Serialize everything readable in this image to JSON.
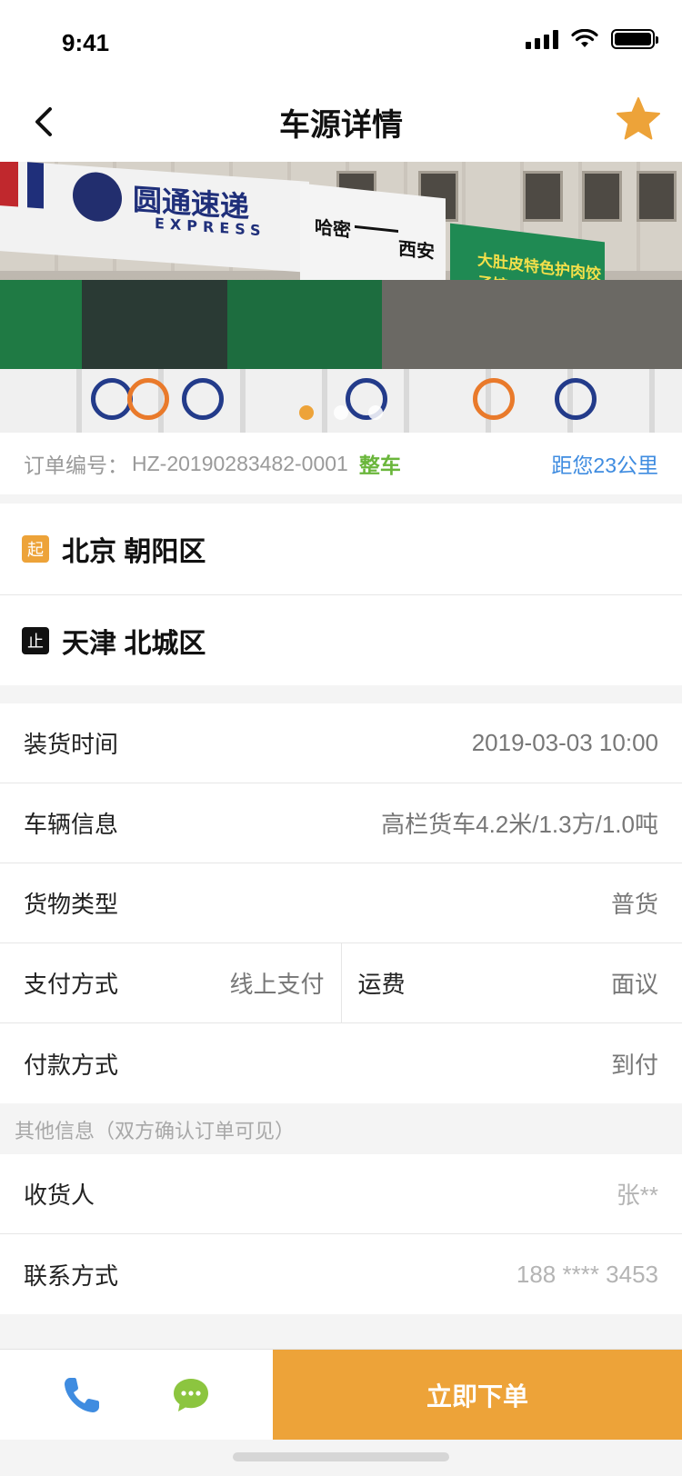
{
  "status_bar": {
    "time": "9:41"
  },
  "nav": {
    "title": "车源详情"
  },
  "banner": {
    "slide_count": 3,
    "active_slide": 1,
    "sign_texts": {
      "yto": "圆通速递",
      "yto_en": "EXPRESS",
      "route_sign": "哈密",
      "route_sign2": "西安",
      "green_sign": "大肚皮特色护肉饺子馆"
    }
  },
  "order": {
    "label": "订单编号：",
    "number": "HZ-20190283482-0001",
    "type": "整车",
    "distance": "距您23公里"
  },
  "route": {
    "start_tag": "起",
    "start": "北京 朝阳区",
    "end_tag": "止",
    "end": "天津 北城区"
  },
  "details": {
    "loading_time_label": "装货时间",
    "loading_time": "2019-03-03 10:00",
    "vehicle_label": "车辆信息",
    "vehicle": "高栏货车4.2米/1.3方/1.0吨",
    "cargo_label": "货物类型",
    "cargo": "普货",
    "payment_label": "支付方式",
    "payment": "线上支付",
    "freight_label": "运费",
    "freight": "面议",
    "pay_term_label": "付款方式",
    "pay_term": "到付"
  },
  "other": {
    "header": "其他信息（双方确认订单可见）",
    "consignee_label": "收货人",
    "consignee": "张**",
    "contact_label": "联系方式",
    "contact": "188 **** 3453"
  },
  "bottom": {
    "order_button": "立即下单"
  },
  "colors": {
    "accent": "#eda339",
    "green": "#6ab63b",
    "blue": "#3f8ce0",
    "chat_green": "#8cc53f"
  },
  "icons": {
    "back": "chevron-left-icon",
    "favorite": "star-icon",
    "phone": "phone-icon",
    "chat": "chat-bubble-icon"
  }
}
